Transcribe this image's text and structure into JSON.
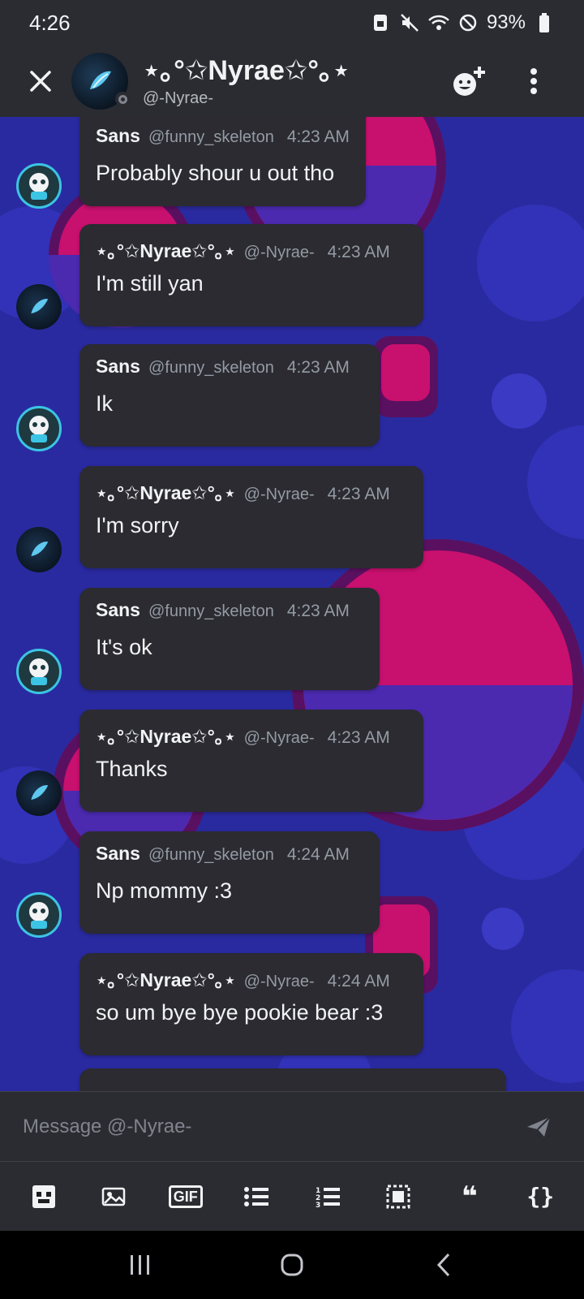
{
  "status_bar": {
    "time": "4:26",
    "battery": "93%"
  },
  "header": {
    "name": "⋆｡°✩Nyrae✩°｡⋆",
    "handle": "@-Nyrae-"
  },
  "messages": [
    {
      "author": "Sans",
      "handle": "@funny_skeleton",
      "time": "4:23 AM",
      "text": "Probably shour u out tho",
      "avatar": "sans-avatar"
    },
    {
      "author": "⋆｡°✩Nyrae✩°｡⋆",
      "handle": "@-Nyrae-",
      "time": "4:23 AM",
      "text": "I'm still yan",
      "avatar": "nyrae-avatar"
    },
    {
      "author": "Sans",
      "handle": "@funny_skeleton",
      "time": "4:23 AM",
      "text": "Ik",
      "avatar": "sans-avatar"
    },
    {
      "author": "⋆｡°✩Nyrae✩°｡⋆",
      "handle": "@-Nyrae-",
      "time": "4:23 AM",
      "text": "I'm sorry",
      "avatar": "nyrae-avatar"
    },
    {
      "author": "Sans",
      "handle": "@funny_skeleton",
      "time": "4:23 AM",
      "text": "It's ok",
      "avatar": "sans-avatar"
    },
    {
      "author": "⋆｡°✩Nyrae✩°｡⋆",
      "handle": "@-Nyrae-",
      "time": "4:23 AM",
      "text": "Thanks",
      "avatar": "nyrae-avatar"
    },
    {
      "author": "Sans",
      "handle": "@funny_skeleton",
      "time": "4:24 AM",
      "text": "Np mommy :3",
      "avatar": "sans-avatar"
    },
    {
      "author": "⋆｡°✩Nyrae✩°｡⋆",
      "handle": "@-Nyrae-",
      "time": "4:24 AM",
      "text": "so um bye bye pookie bear :3",
      "avatar": "nyrae-avatar"
    }
  ],
  "composer": {
    "placeholder": "Message @-Nyrae-"
  },
  "toolbar": {
    "gif_label": "GIF",
    "quote_label": "❝",
    "code_label": "{}"
  },
  "colors": {
    "bubble": "#2b2b31",
    "background_blue": "#2a2aa0",
    "background_pink": "#c8106e",
    "sans_ring": "#3bc4e4"
  }
}
